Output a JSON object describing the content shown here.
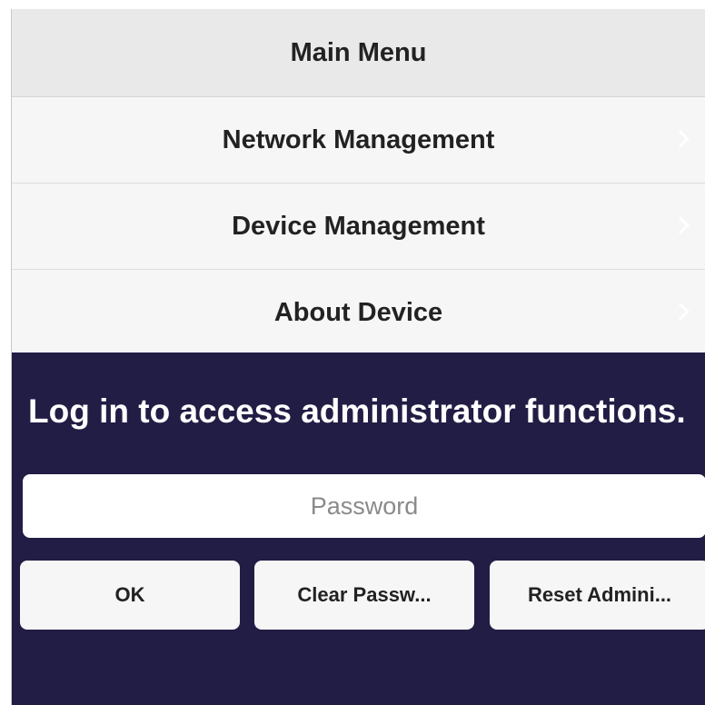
{
  "header": {
    "title": "Main Menu"
  },
  "menu": {
    "items": [
      {
        "label": "Network Management",
        "icon": "chevron-right-icon"
      },
      {
        "label": "Device Management",
        "icon": "chevron-right-icon"
      },
      {
        "label": "About Device",
        "icon": "chevron-right-icon"
      }
    ]
  },
  "login": {
    "title": "Log in to access administrator functions.",
    "password_placeholder": "Password",
    "password_value": "",
    "ok_label": "OK",
    "clear_label": "Clear Passw...",
    "reset_label": "Reset Admini..."
  },
  "colors": {
    "panel_background": "#221d45",
    "header_background": "#e9e9e9",
    "menu_background": "#f6f6f6"
  }
}
